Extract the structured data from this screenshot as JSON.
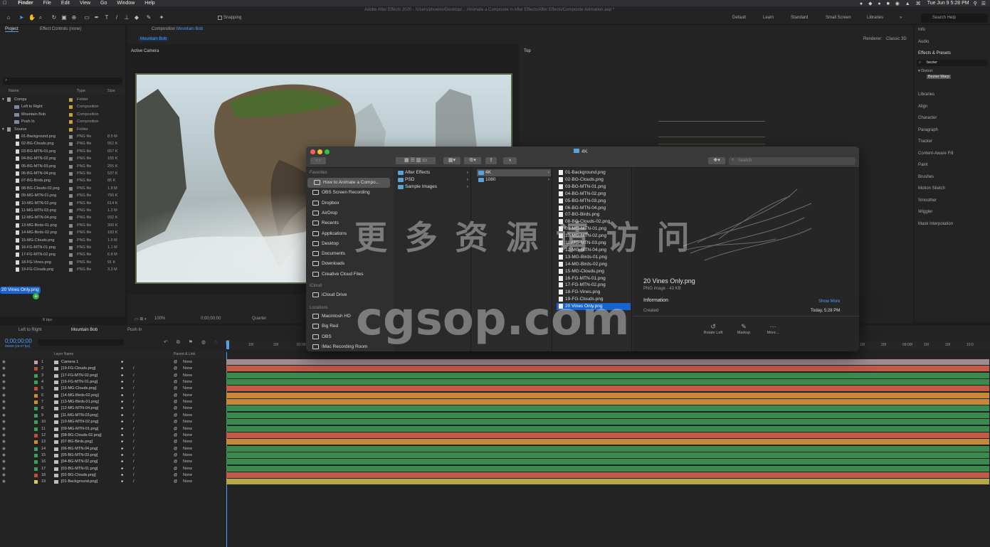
{
  "menubar": {
    "apple_icon": "apple-icon",
    "app": "Finder",
    "items": [
      "File",
      "Edit",
      "View",
      "Go",
      "Window",
      "Help"
    ],
    "clock": "Tue Jun 9  5:28 PM"
  },
  "toolbar": {
    "title": "Adobe After Effects 2020 - /Users/phoenix/Desktop/... /Animate a Composite in After Effects/After Effects/Composite Animation.aep *",
    "snapping": "Snapping",
    "workspaces": [
      "Default",
      "Learn",
      "Standard",
      "Small Screen",
      "Libraries"
    ],
    "search_help": "Search Help"
  },
  "project_panel": {
    "tab_project": "Project",
    "tab_effect_controls": "Effect Controls (none)",
    "columns": {
      "name": "Name",
      "type": "Type",
      "size": "Size"
    },
    "items": [
      {
        "name": "Comps",
        "type": "Folder",
        "size": "",
        "kind": "folder",
        "label": "#c9a33a"
      },
      {
        "name": "Left to Right",
        "type": "Composition",
        "size": "",
        "kind": "comp",
        "label": "#c9a33a"
      },
      {
        "name": "Mountain Bob",
        "type": "Composition",
        "size": "",
        "kind": "comp",
        "label": "#c9a33a"
      },
      {
        "name": "Push In",
        "type": "Composition",
        "size": "",
        "kind": "comp",
        "label": "#c9a33a"
      },
      {
        "name": "Source",
        "type": "Folder",
        "size": "",
        "kind": "folder",
        "label": "#c9a33a"
      },
      {
        "name": "01-Background.png",
        "type": "PNG file",
        "size": "8.5 M",
        "kind": "file",
        "label": "#8a8a8a"
      },
      {
        "name": "02-BG-Clouds.png",
        "type": "PNG file",
        "size": "552 K",
        "kind": "file",
        "label": "#8a8a8a"
      },
      {
        "name": "03-BG-MTN-01.png",
        "type": "PNG file",
        "size": "657 K",
        "kind": "file",
        "label": "#8a8a8a"
      },
      {
        "name": "04-BG-MTN-02.png",
        "type": "PNG file",
        "size": "155 K",
        "kind": "file",
        "label": "#8a8a8a"
      },
      {
        "name": "05-BG-MTN-03.png",
        "type": "PNG file",
        "size": "255 K",
        "kind": "file",
        "label": "#8a8a8a"
      },
      {
        "name": "06-BG-MTN-04.png",
        "type": "PNG file",
        "size": "537 K",
        "kind": "file",
        "label": "#8a8a8a"
      },
      {
        "name": "07-BG-Birds.png",
        "type": "PNG file",
        "size": "85 K",
        "kind": "file",
        "label": "#8a8a8a"
      },
      {
        "name": "08-BG-Clouds-02.png",
        "type": "PNG file",
        "size": "1.8 M",
        "kind": "file",
        "label": "#8a8a8a"
      },
      {
        "name": "09-MG-MTN-01.png",
        "type": "PNG file",
        "size": "790 K",
        "kind": "file",
        "label": "#8a8a8a"
      },
      {
        "name": "10-MG-MTN-02.png",
        "type": "PNG file",
        "size": "614 K",
        "kind": "file",
        "label": "#8a8a8a"
      },
      {
        "name": "11-MG-MTN-03.png",
        "type": "PNG file",
        "size": "1.2 M",
        "kind": "file",
        "label": "#8a8a8a"
      },
      {
        "name": "12-MG-MTN-04.png",
        "type": "PNG file",
        "size": "932 K",
        "kind": "file",
        "label": "#8a8a8a"
      },
      {
        "name": "13-MG-Birds-01.png",
        "type": "PNG file",
        "size": "200 K",
        "kind": "file",
        "label": "#8a8a8a"
      },
      {
        "name": "14-MG-Birds-02.png",
        "type": "PNG file",
        "size": "183 K",
        "kind": "file",
        "label": "#8a8a8a"
      },
      {
        "name": "15-MG-Clouds.png",
        "type": "PNG file",
        "size": "1.5 M",
        "kind": "file",
        "label": "#8a8a8a"
      },
      {
        "name": "16-FG-MTN-01.png",
        "type": "PNG file",
        "size": "1.1 M",
        "kind": "file",
        "label": "#8a8a8a"
      },
      {
        "name": "17-FG-MTN-02.png",
        "type": "PNG file",
        "size": "6.8 M",
        "kind": "file",
        "label": "#8a8a8a"
      },
      {
        "name": "18-FG-Vines.png",
        "type": "PNG file",
        "size": "91 K",
        "kind": "file",
        "label": "#8a8a8a"
      },
      {
        "name": "19-FG-Clouds.png",
        "type": "PNG file",
        "size": "3.3 M",
        "kind": "file",
        "label": "#8a8a8a"
      }
    ],
    "drag_label": "20 Vines Only.png",
    "bpc": "8 bpc"
  },
  "composition": {
    "tab": "Composition",
    "comp_name": "Mountain Bob",
    "sub_tab": "Mountain Bob",
    "active_camera": "Active Camera",
    "top_view": "Top",
    "renderer_label": "Renderer:",
    "renderer": "Classic 3D",
    "zoom": "100%",
    "timecode": "0;00;00;00",
    "resolution": "Quarter"
  },
  "right_panel": {
    "info": "Info",
    "audio": "Audio",
    "effects_presets": "Effects & Presets",
    "search_value": "bezier",
    "category": "Distort",
    "effect": "Bezier Warp",
    "panels": [
      "Libraries",
      "Align",
      "Character",
      "Paragraph",
      "Tracker",
      "Content-Aware Fill",
      "Paint",
      "Brushes",
      "Motion Sketch",
      "Smoother",
      "Wiggler",
      "Mask Interpolation"
    ]
  },
  "timeline": {
    "tabs": [
      "Left to Right",
      "Mountain Bob",
      "Push In"
    ],
    "timecode": "0;00;00;00",
    "fps": "00000 (29.97 fps)",
    "col_layer_name": "Layer Name",
    "col_parent": "Parent & Link",
    "ruler": [
      "0f",
      "10f",
      "20f",
      "01:00f",
      "10f",
      "20f",
      "09:00f",
      "10f",
      "20f",
      "10:0"
    ],
    "layers": [
      {
        "num": "1",
        "name": "Camera 1",
        "color": "#c2a0a8",
        "bar": "#a08a90"
      },
      {
        "num": "2",
        "name": "[19-FG-Clouds.png]",
        "color": "#c34c3c",
        "bar": "#c15a47"
      },
      {
        "num": "3",
        "name": "[17-FG-MTN-02.png]",
        "color": "#3aa05a",
        "bar": "#3c8a4e"
      },
      {
        "num": "4",
        "name": "[16-FG-MTN-01.png]",
        "color": "#3aa05a",
        "bar": "#3c8a4e"
      },
      {
        "num": "5",
        "name": "[15-MG-Clouds.png]",
        "color": "#c34c3c",
        "bar": "#c15a47"
      },
      {
        "num": "6",
        "name": "[14-MG-Birds-02.png]",
        "color": "#d08a30",
        "bar": "#c78837"
      },
      {
        "num": "7",
        "name": "[13-MG-Birds-01.png]",
        "color": "#d08a30",
        "bar": "#c78837"
      },
      {
        "num": "8",
        "name": "[12-MG-MTN-04.png]",
        "color": "#3aa05a",
        "bar": "#3c8a4e"
      },
      {
        "num": "9",
        "name": "[11-MG-MTN-03.png]",
        "color": "#3aa05a",
        "bar": "#3c8a4e"
      },
      {
        "num": "10",
        "name": "[10-MG-MTN-02.png]",
        "color": "#3aa05a",
        "bar": "#3c8a4e"
      },
      {
        "num": "11",
        "name": "[09-MG-MTN-01.png]",
        "color": "#3aa05a",
        "bar": "#3c8a4e"
      },
      {
        "num": "12",
        "name": "[08-BG-Clouds-02.png]",
        "color": "#c34c3c",
        "bar": "#c15a47"
      },
      {
        "num": "13",
        "name": "[07-BG-Birds.png]",
        "color": "#d08a30",
        "bar": "#c78837"
      },
      {
        "num": "14",
        "name": "[06-BG-MTN-04.png]",
        "color": "#3aa05a",
        "bar": "#3c8a4e"
      },
      {
        "num": "15",
        "name": "[05-BG-MTN-03.png]",
        "color": "#3aa05a",
        "bar": "#3c8a4e"
      },
      {
        "num": "16",
        "name": "[04-BG-MTN-02.png]",
        "color": "#3aa05a",
        "bar": "#3c8a4e"
      },
      {
        "num": "17",
        "name": "[03-BG-MTN-01.png]",
        "color": "#3aa05a",
        "bar": "#3c8a4e"
      },
      {
        "num": "18",
        "name": "[02-BG-Clouds.png]",
        "color": "#c34c3c",
        "bar": "#c15a47"
      },
      {
        "num": "19",
        "name": "[01-Background.png]",
        "color": "#d8c85a",
        "bar": "#b8a844"
      }
    ],
    "parent_value": "None"
  },
  "finder": {
    "title": "4K",
    "search_placeholder": "Search",
    "favorites_heading": "Favorites",
    "favorites": [
      "How to Animate a Compo...",
      "OBS Screen Recording",
      "Dropbox",
      "AirDrop",
      "Recents",
      "Applications",
      "Desktop",
      "Documents",
      "Downloads",
      "Creative Cloud Files"
    ],
    "icloud_heading": "iCloud",
    "icloud": [
      "iCloud Drive"
    ],
    "locations_heading": "Locations",
    "locations": [
      "Macintosh HD",
      "Big Red",
      "OBS",
      "iMac Recording Room"
    ],
    "col1": [
      "After Effects",
      "PSD",
      "Sample Images"
    ],
    "col2": [
      "4K",
      "1080"
    ],
    "col3": [
      "01-Background.png",
      "02-BG-Clouds.png",
      "03-BG-MTN-01.png",
      "04-BG-MTN-02.png",
      "05-BG-MTN-03.png",
      "06-BG-MTN-04.png",
      "07-BG-Birds.png",
      "08-BG-Clouds-02.png",
      "09-MG-MTN-01.png",
      "10-MG-MTN-02.png",
      "11-MG-MTN-03.png",
      "12-MG-MTN-04.png",
      "13-MG-Birds-01.png",
      "14-MG-Birds-02.png",
      "15-MG-Clouds.png",
      "16-FG-MTN-01.png",
      "17-FG-MTN-02.png",
      "18-FG-Vines.png",
      "19-FG-Clouds.png",
      "20 Vines Only.png"
    ],
    "preview_name": "20 Vines Only.png",
    "preview_kind": "PNG image - 43 KB",
    "info_heading": "Information",
    "show_more": "Show More",
    "created_label": "Created",
    "created_value": "Today, 5:28 PM",
    "actions": [
      "Rotate Left",
      "Markup",
      "More..."
    ]
  },
  "watermark": {
    "line1": "更 多 资 源 请 访 问",
    "line2": "cgsop.com"
  }
}
